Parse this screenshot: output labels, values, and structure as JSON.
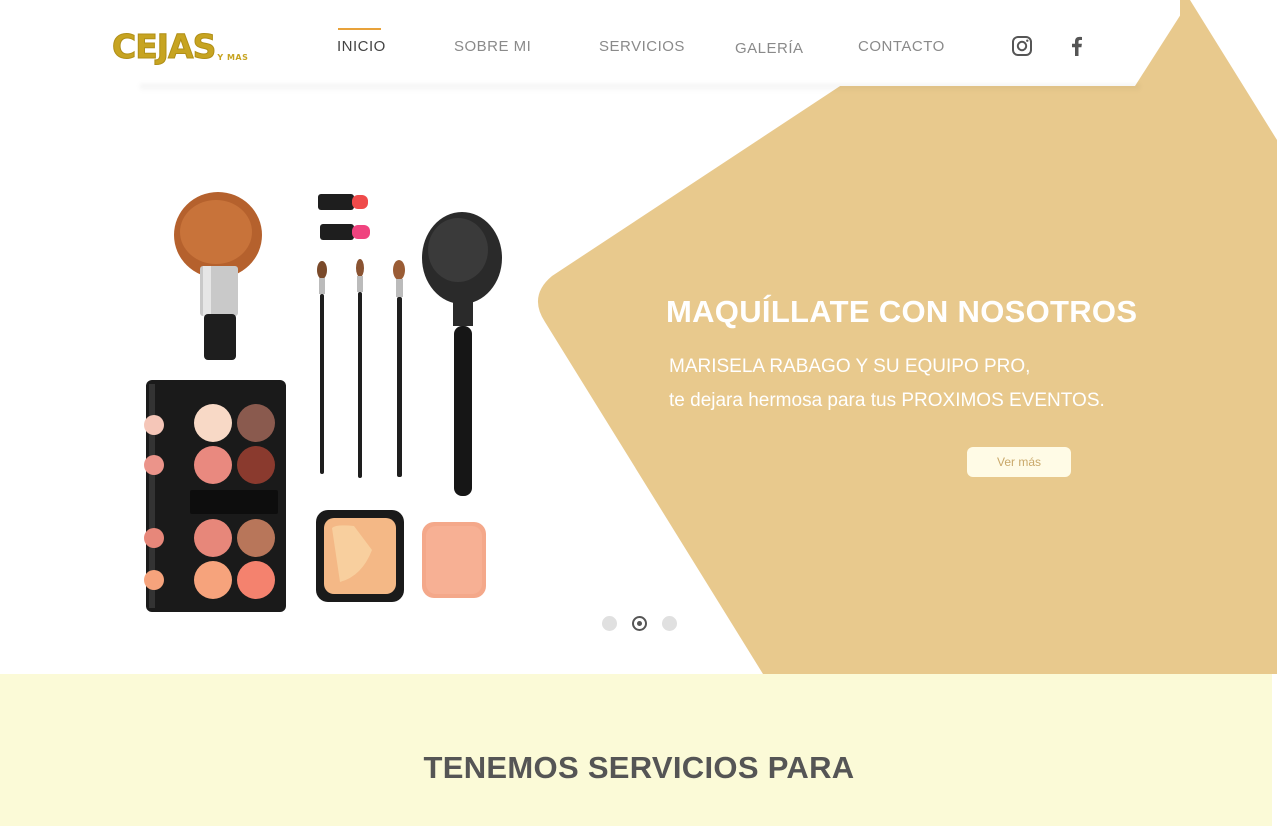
{
  "brand": {
    "logo_text": "CEJAS",
    "logo_sub": "Y MAS",
    "accent_color": "#e8a23a",
    "hero_color": "#e8c98d",
    "logo_color": "#c7a421"
  },
  "nav": {
    "items": [
      {
        "label": "INICIO",
        "active": true
      },
      {
        "label": "SOBRE MI",
        "active": false
      },
      {
        "label": "SERVICIOS",
        "active": false
      },
      {
        "label": "GALERÍA",
        "active": false
      },
      {
        "label": "CONTACTO",
        "active": false
      }
    ],
    "social": [
      {
        "icon": "instagram-icon"
      },
      {
        "icon": "facebook-icon"
      }
    ]
  },
  "hero": {
    "title": "MAQUÍLLATE CON NOSOTROS",
    "line1": "MARISELA RABAGO Y SU EQUIPO PRO,",
    "line2": "te dejara hermosa para tus PROXIMOS EVENTOS.",
    "button_label": "Ver más",
    "image_icon": "makeup-products-image",
    "slides_total": 3,
    "slide_active": 2
  },
  "services": {
    "title": "TENEMOS SERVICIOS PARA"
  }
}
